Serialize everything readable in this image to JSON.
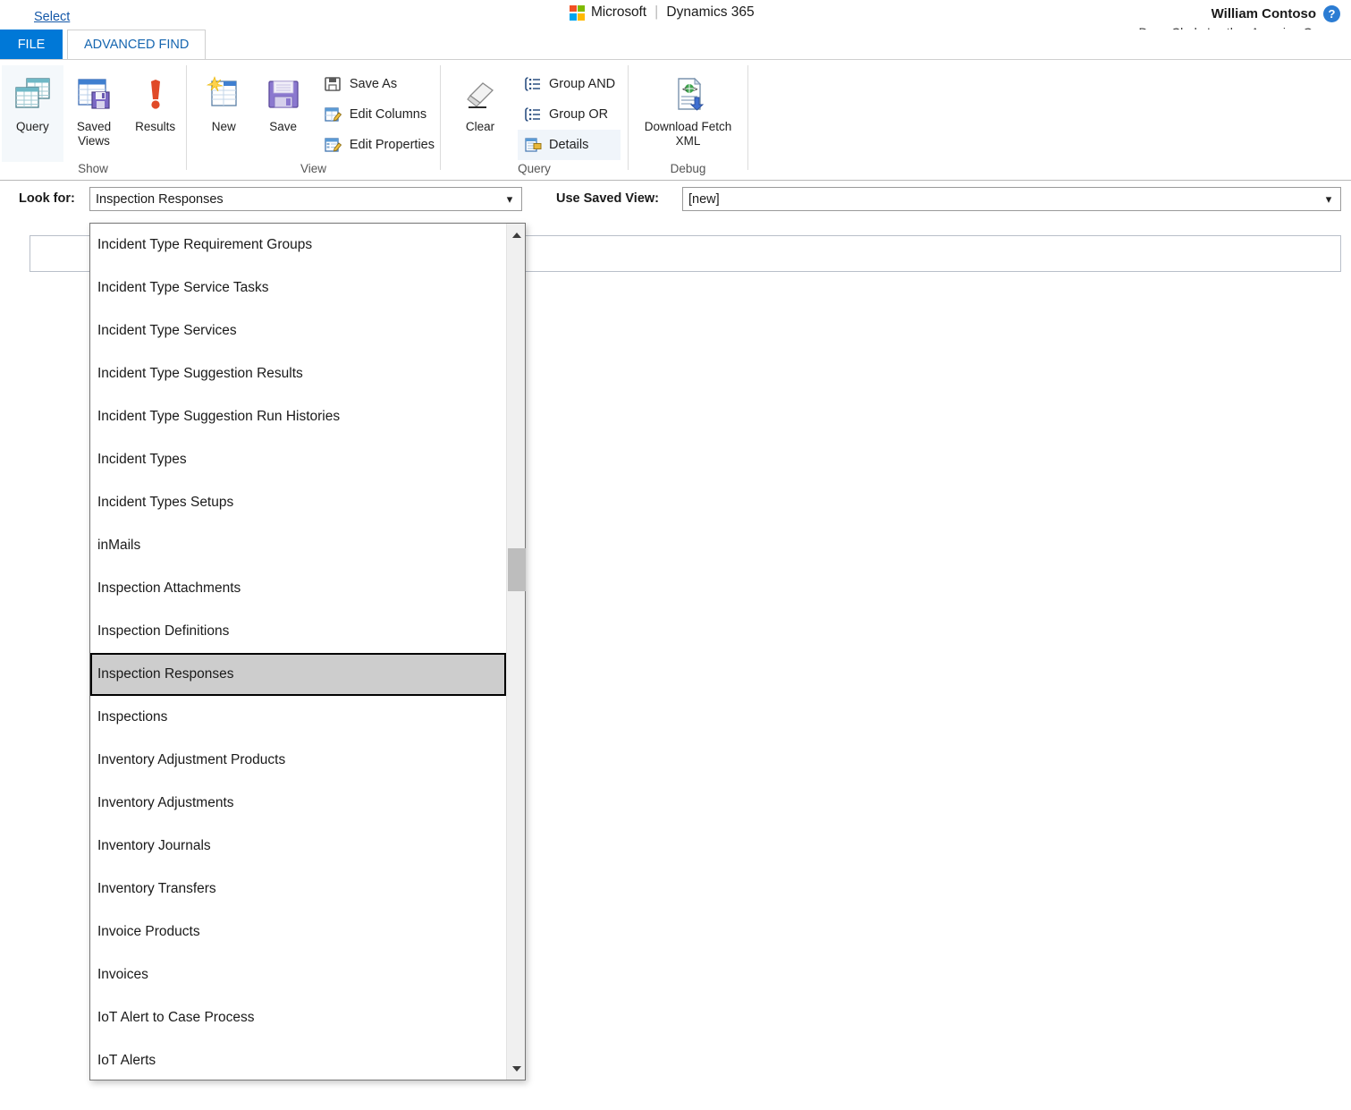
{
  "header": {
    "microsoft_label": "Microsoft",
    "product_label": "Dynamics 365",
    "separator": "|",
    "user_name": "William Contoso",
    "org_name": "Dave Clarke's other Amazing Org",
    "help_icon": "question-mark-icon",
    "org_chevron_icon": "chevron-up-icon"
  },
  "tabs": {
    "file": "FILE",
    "advanced_find": "ADVANCED FIND"
  },
  "ribbon": {
    "groups": [
      {
        "label": "Show",
        "buttons": [
          {
            "label": "Query",
            "icon": "query-grid-icon",
            "active": true
          },
          {
            "label": "Saved\nViews",
            "label_line1": "Saved",
            "label_line2": "Views",
            "icon": "saved-views-icon",
            "active": false
          },
          {
            "label": "Results",
            "icon": "results-exclamation-icon",
            "active": false
          }
        ]
      },
      {
        "label": "View",
        "buttons": [
          {
            "label": "New",
            "icon": "new-record-icon"
          },
          {
            "label": "Save",
            "icon": "save-floppy-icon"
          }
        ],
        "small_buttons": [
          {
            "label": "Save As",
            "icon": "save-as-icon"
          },
          {
            "label": "Edit Columns",
            "icon": "edit-columns-icon"
          },
          {
            "label": "Edit Properties",
            "icon": "edit-properties-icon"
          }
        ]
      },
      {
        "label": "Query",
        "buttons": [
          {
            "label": "Clear",
            "icon": "eraser-icon"
          }
        ],
        "small_buttons": [
          {
            "label": "Group AND",
            "icon": "group-and-icon"
          },
          {
            "label": "Group OR",
            "icon": "group-or-icon"
          },
          {
            "label": "Details",
            "icon": "details-icon",
            "highlighted": true
          }
        ]
      },
      {
        "label": "Debug",
        "buttons": [
          {
            "label_line1": "Download Fetch",
            "label_line2": "XML",
            "icon": "download-fetch-xml-icon"
          }
        ]
      }
    ]
  },
  "query_form": {
    "look_for_label": "Look for:",
    "look_for_value": "Inspection Responses",
    "use_saved_view_label": "Use Saved View:",
    "use_saved_view_value": "[new]",
    "select_link": "Select",
    "chevron_icon": "chevron-down-icon"
  },
  "dropdown": {
    "selected_value": "Inspection Responses",
    "scroll_up_icon": "scroll-arrow-up-icon",
    "scroll_down_icon": "scroll-arrow-down-icon",
    "items": [
      {
        "label": "Incident Type Requirement Groups",
        "selected": false
      },
      {
        "label": "Incident Type Service Tasks",
        "selected": false
      },
      {
        "label": "Incident Type Services",
        "selected": false
      },
      {
        "label": "Incident Type Suggestion Results",
        "selected": false
      },
      {
        "label": "Incident Type Suggestion Run Histories",
        "selected": false
      },
      {
        "label": "Incident Types",
        "selected": false
      },
      {
        "label": "Incident Types Setups",
        "selected": false
      },
      {
        "label": "inMails",
        "selected": false
      },
      {
        "label": "Inspection Attachments",
        "selected": false
      },
      {
        "label": "Inspection Definitions",
        "selected": false
      },
      {
        "label": "Inspection Responses",
        "selected": true
      },
      {
        "label": "Inspections",
        "selected": false
      },
      {
        "label": "Inventory Adjustment Products",
        "selected": false
      },
      {
        "label": "Inventory Adjustments",
        "selected": false
      },
      {
        "label": "Inventory Journals",
        "selected": false
      },
      {
        "label": "Inventory Transfers",
        "selected": false
      },
      {
        "label": "Invoice Products",
        "selected": false
      },
      {
        "label": "Invoices",
        "selected": false
      },
      {
        "label": "IoT Alert to Case Process",
        "selected": false
      },
      {
        "label": "IoT Alerts",
        "selected": false
      }
    ]
  },
  "colors": {
    "file_tab_blue": "#0078d7",
    "tab_text_blue": "#1666b0",
    "link_blue": "#1558a8",
    "selected_item_gray": "#cdcdcd",
    "help_icon_blue": "#2b7cd3"
  }
}
